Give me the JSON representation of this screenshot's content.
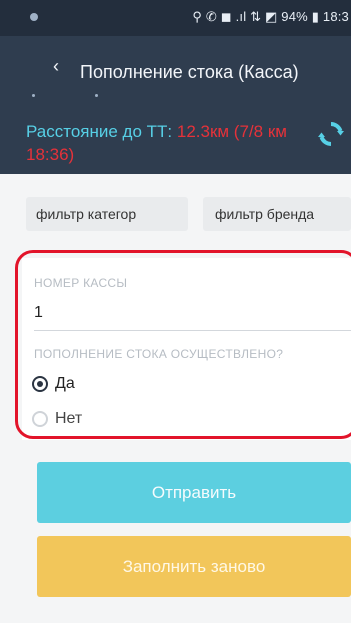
{
  "status_bar": {
    "right_text": "⚲ ✆ ◼ .ıl ⇅ ◩ 94% ▮ 18:3"
  },
  "header": {
    "back_icon": "chevron-left-icon",
    "title": "Пополнение стока (Касса)"
  },
  "distance": {
    "label": "Расстояние до ТТ:",
    "value": "12.3км (7/8 км 18:36)",
    "refresh_icon": "refresh-icon",
    "colors": {
      "label": "#57d0e6",
      "value": "#e5323a"
    }
  },
  "filters": {
    "category": "фильтр категор",
    "brand": "фильтр бренда"
  },
  "form": {
    "register_label": "НОМЕР КАССЫ",
    "register_value": "1",
    "restock_label": "ПОПОЛНЕНИЕ СТОКА ОСУЩЕСТВЛЕНО?",
    "options": [
      {
        "label": "Да",
        "checked": true
      },
      {
        "label": "Нет",
        "checked": false
      }
    ]
  },
  "actions": {
    "send_label": "Отправить",
    "reset_label": "Заполнить заново",
    "colors": {
      "send": "#5ccfe0",
      "reset": "#f2c65a"
    }
  }
}
